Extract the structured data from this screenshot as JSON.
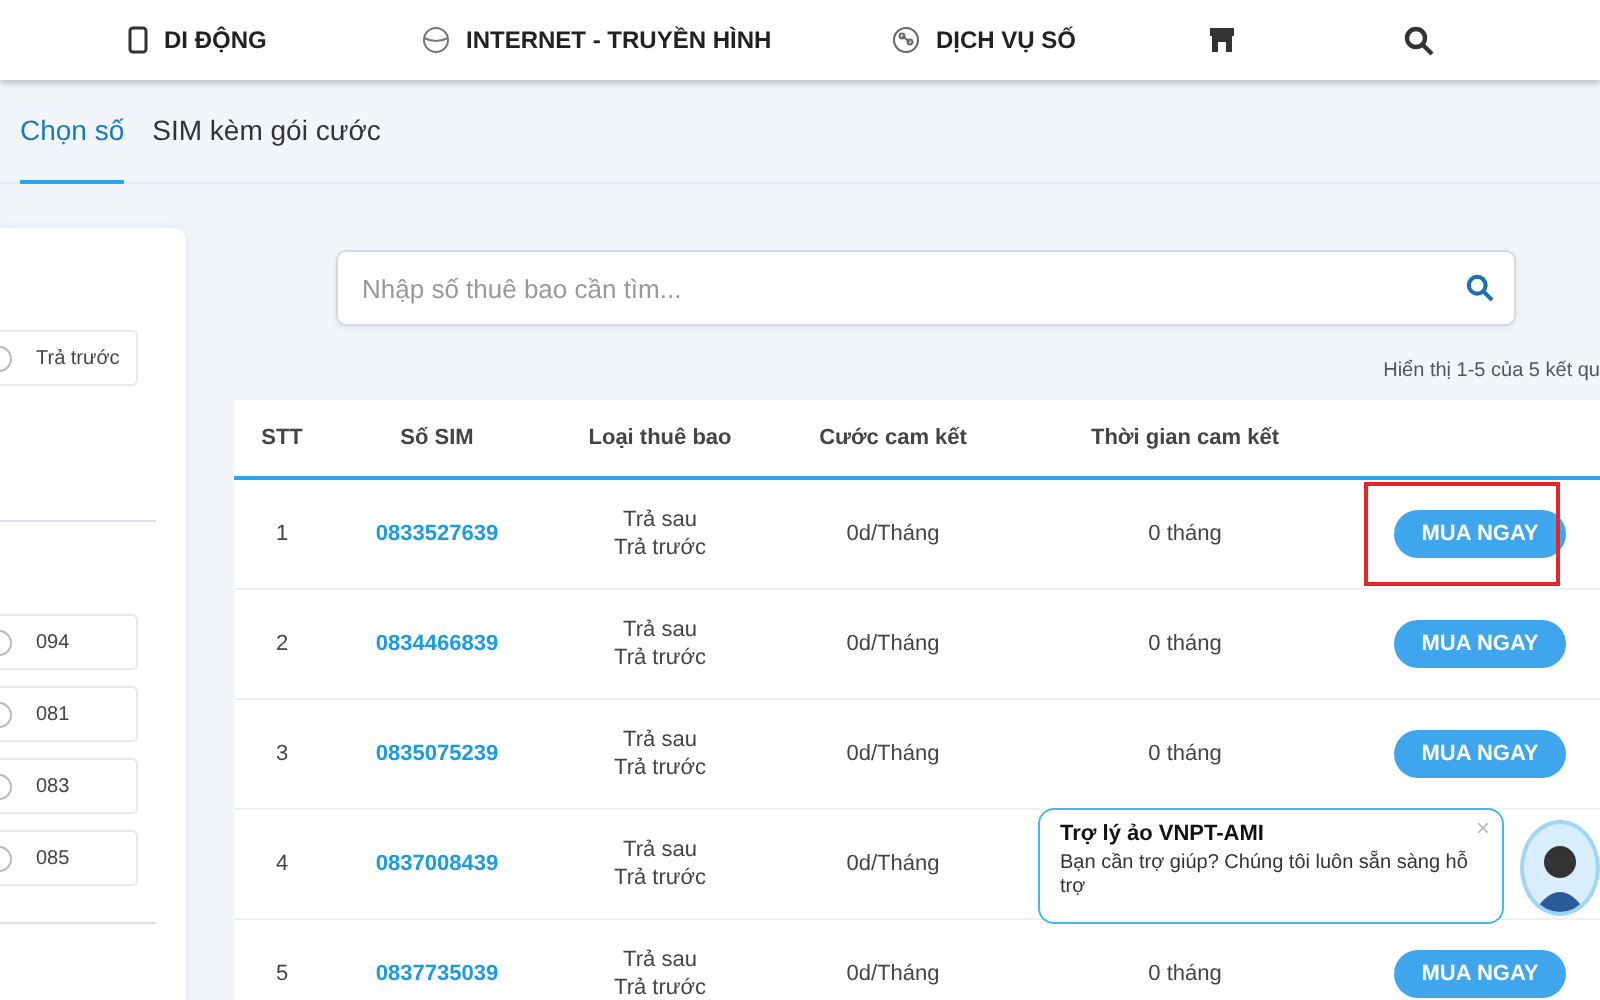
{
  "nav": [
    {
      "label": "DI ĐỘNG"
    },
    {
      "label": "INTERNET - TRUYỀN HÌNH"
    },
    {
      "label": "DỊCH VỤ SỐ"
    }
  ],
  "tabs": [
    {
      "label": "Chọn số",
      "selected": true
    },
    {
      "label": "SIM kèm gói cước",
      "selected": false
    }
  ],
  "filters": {
    "type_options": [
      {
        "label": "Trả trước",
        "selected": false
      }
    ],
    "prefix_options": [
      {
        "label": "094",
        "selected": false
      },
      {
        "label": "081",
        "selected": false
      },
      {
        "label": "083",
        "selected": false
      },
      {
        "label": "085",
        "selected": false
      }
    ]
  },
  "search": {
    "placeholder": "Nhập số thuê bao cần tìm..."
  },
  "result_count": "Hiển thị 1-5 của 5 kết qu",
  "table": {
    "columns": [
      "STT",
      "Số SIM",
      "Loại thuê bao",
      "Cước cam kết",
      "Thời gian cam kết"
    ],
    "rows": [
      {
        "stt": "1",
        "sim": "0833527639",
        "types": [
          "Trả sau",
          "Trả trước"
        ],
        "fee": "0d/Tháng",
        "term": "0 tháng",
        "button": "MUA NGAY",
        "highlighted": true
      },
      {
        "stt": "2",
        "sim": "0834466839",
        "types": [
          "Trả sau",
          "Trả trước"
        ],
        "fee": "0d/Tháng",
        "term": "0 tháng",
        "button": "MUA NGAY",
        "highlighted": false
      },
      {
        "stt": "3",
        "sim": "0835075239",
        "types": [
          "Trả sau",
          "Trả trước"
        ],
        "fee": "0d/Tháng",
        "term": "0 tháng",
        "button": "MUA NGAY",
        "highlighted": false
      },
      {
        "stt": "4",
        "sim": "0837008439",
        "types": [
          "Trả sau",
          "Trả trước"
        ],
        "fee": "0d/Tháng",
        "highlighted": false
      },
      {
        "stt": "5",
        "sim": "0837735039",
        "types": [
          "Trả sau",
          "Trả trước"
        ],
        "fee": "0d/Tháng",
        "term": "0 tháng",
        "button": "MUA NGAY",
        "highlighted": false
      }
    ]
  },
  "chat": {
    "title": "Trợ lý ảo VNPT-AMI",
    "message": "Bạn cần trợ giúp? Chúng tôi luôn sẵn sàng hỗ trợ",
    "close": "×"
  }
}
